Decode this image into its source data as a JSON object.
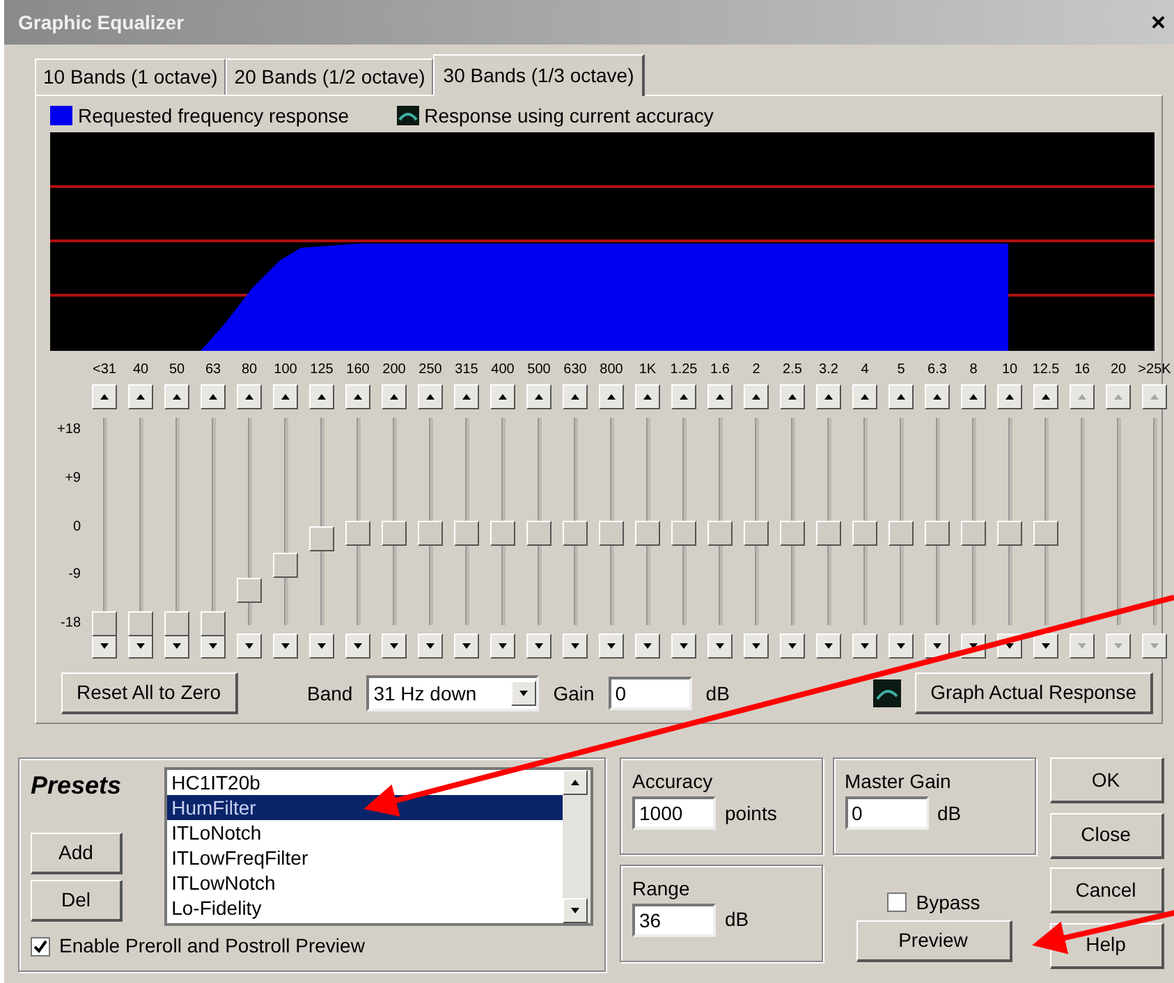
{
  "window": {
    "title": "Graphic Equalizer",
    "close_button": "×"
  },
  "tabs": [
    {
      "label": "10 Bands (1 octave)",
      "selected": false
    },
    {
      "label": "20 Bands (1/2 octave)",
      "selected": false
    },
    {
      "label": "30 Bands (1/3 octave)",
      "selected": true
    }
  ],
  "legend": [
    {
      "label": "Requested frequency response",
      "kind": "requested"
    },
    {
      "label": "Response using current accuracy",
      "kind": "actual"
    }
  ],
  "scale_labels": [
    "+18",
    "+9",
    "0",
    "-9",
    "-18"
  ],
  "bands": [
    {
      "label": "<31",
      "level": 0,
      "disabled": false
    },
    {
      "label": "40",
      "level": 0,
      "disabled": false
    },
    {
      "label": "50",
      "level": 0,
      "disabled": false
    },
    {
      "label": "63",
      "level": 0,
      "disabled": false
    },
    {
      "label": "80",
      "level": 0.17,
      "disabled": false
    },
    {
      "label": "100",
      "level": 0.3,
      "disabled": false
    },
    {
      "label": "125",
      "level": 0.44,
      "disabled": false
    },
    {
      "label": "160",
      "level": 0.47,
      "disabled": false
    },
    {
      "label": "200",
      "level": 0.47,
      "disabled": false
    },
    {
      "label": "250",
      "level": 0.47,
      "disabled": false
    },
    {
      "label": "315",
      "level": 0.47,
      "disabled": false
    },
    {
      "label": "400",
      "level": 0.47,
      "disabled": false
    },
    {
      "label": "500",
      "level": 0.47,
      "disabled": false
    },
    {
      "label": "630",
      "level": 0.47,
      "disabled": false
    },
    {
      "label": "800",
      "level": 0.47,
      "disabled": false
    },
    {
      "label": "1K",
      "level": 0.47,
      "disabled": false
    },
    {
      "label": "1.25",
      "level": 0.47,
      "disabled": false
    },
    {
      "label": "1.6",
      "level": 0.47,
      "disabled": false
    },
    {
      "label": "2",
      "level": 0.47,
      "disabled": false
    },
    {
      "label": "2.5",
      "level": 0.47,
      "disabled": false
    },
    {
      "label": "3.2",
      "level": 0.47,
      "disabled": false
    },
    {
      "label": "4",
      "level": 0.47,
      "disabled": false
    },
    {
      "label": "5",
      "level": 0.47,
      "disabled": false
    },
    {
      "label": "6.3",
      "level": 0.47,
      "disabled": false
    },
    {
      "label": "8",
      "level": 0.47,
      "disabled": false
    },
    {
      "label": "10",
      "level": 0.47,
      "disabled": false
    },
    {
      "label": "12.5",
      "level": 0.47,
      "disabled": false
    },
    {
      "label": "16",
      "disabled": true
    },
    {
      "label": "20",
      "disabled": true
    },
    {
      "label": ">25K",
      "disabled": true
    }
  ],
  "band_controls": {
    "reset_button": "Reset All to Zero",
    "band_label": "Band",
    "band_value": "31 Hz down",
    "gain_label": "Gain",
    "gain_value": "0",
    "gain_unit": "dB",
    "graph_button": "Graph Actual Response"
  },
  "presets": {
    "title": "Presets",
    "items": [
      {
        "label": "HC1IT20b",
        "selected": false
      },
      {
        "label": "HumFilter",
        "selected": true
      },
      {
        "label": "ITLoNotch",
        "selected": false
      },
      {
        "label": "ITLowFreqFilter",
        "selected": false
      },
      {
        "label": "ITLowNotch",
        "selected": false
      },
      {
        "label": "Lo-Fidelity",
        "selected": false
      }
    ],
    "add_button": "Add",
    "del_button": "Del",
    "preroll": {
      "label": "Enable Preroll and Postroll Preview",
      "checked": true
    }
  },
  "accuracy": {
    "title": "Accuracy",
    "value": "1000",
    "unit": "points"
  },
  "master_gain": {
    "title": "Master Gain",
    "value": "0",
    "unit": "dB"
  },
  "range": {
    "title": "Range",
    "value": "36",
    "unit": "dB"
  },
  "bypass": {
    "label": "Bypass",
    "checked": false
  },
  "preview_button": "Preview",
  "dialog_buttons": [
    "OK",
    "Close",
    "Cancel",
    "Help"
  ],
  "annotations": [
    {
      "kind": "arrow"
    },
    {
      "kind": "arrow"
    }
  ]
}
